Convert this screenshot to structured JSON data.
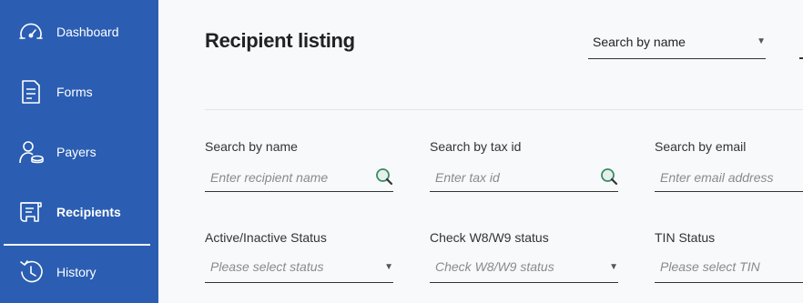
{
  "sidebar": {
    "items": [
      {
        "label": "Dashboard",
        "icon": "dashboard-icon"
      },
      {
        "label": "Forms",
        "icon": "document-icon"
      },
      {
        "label": "Payers",
        "icon": "user-coins-icon"
      },
      {
        "label": "Recipients",
        "icon": "receipt-icon",
        "active": true
      },
      {
        "label": "History",
        "icon": "history-icon"
      }
    ]
  },
  "header": {
    "title": "Recipient listing",
    "search_select": "Search by name"
  },
  "filters": {
    "row1": [
      {
        "label": "Search by name",
        "placeholder": "Enter recipient name"
      },
      {
        "label": "Search by tax id",
        "placeholder": "Enter tax id"
      },
      {
        "label": "Search by email",
        "placeholder": "Enter email address"
      }
    ],
    "row2": [
      {
        "label": "Active/Inactive Status",
        "placeholder": "Please select status"
      },
      {
        "label": "Check W8/W9 status",
        "placeholder": "Check W8/W9 status"
      },
      {
        "label": "TIN Status",
        "placeholder": "Please select TIN"
      }
    ]
  },
  "colors": {
    "sidebar_bg": "#2b5eb2",
    "search_icon": "#3a8a6a"
  }
}
